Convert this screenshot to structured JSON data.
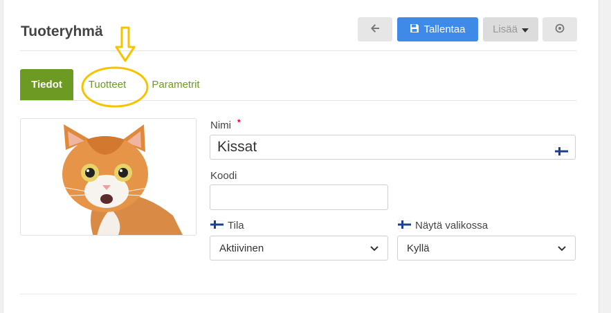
{
  "header": {
    "title": "Tuoteryhmä",
    "save_label": "Tallentaa",
    "more_label": "Lisää"
  },
  "tabs": [
    {
      "label": "Tiedot",
      "active": true
    },
    {
      "label": "Tuotteet",
      "active": false
    },
    {
      "label": "Parametrit",
      "active": false
    }
  ],
  "form": {
    "name_label": "Nimi",
    "name_required_mark": "*",
    "name_value": "Kissat",
    "code_label": "Koodi",
    "code_value": "",
    "status_label": "Tila",
    "status_value": "Aktiivinen",
    "show_in_menu_label": "Näytä valikossa",
    "show_in_menu_value": "Kyllä"
  },
  "icons": {
    "back": "arrow-left-icon",
    "save": "floppy-disk-icon",
    "more": "caret-down-icon",
    "circle": "circle-dot-icon",
    "flag": "finland-flag-icon"
  },
  "colors": {
    "primary": "#3f8ae6",
    "tab_active": "#6c9a22",
    "annotation": "#f5c400",
    "required": "#d9001b"
  }
}
